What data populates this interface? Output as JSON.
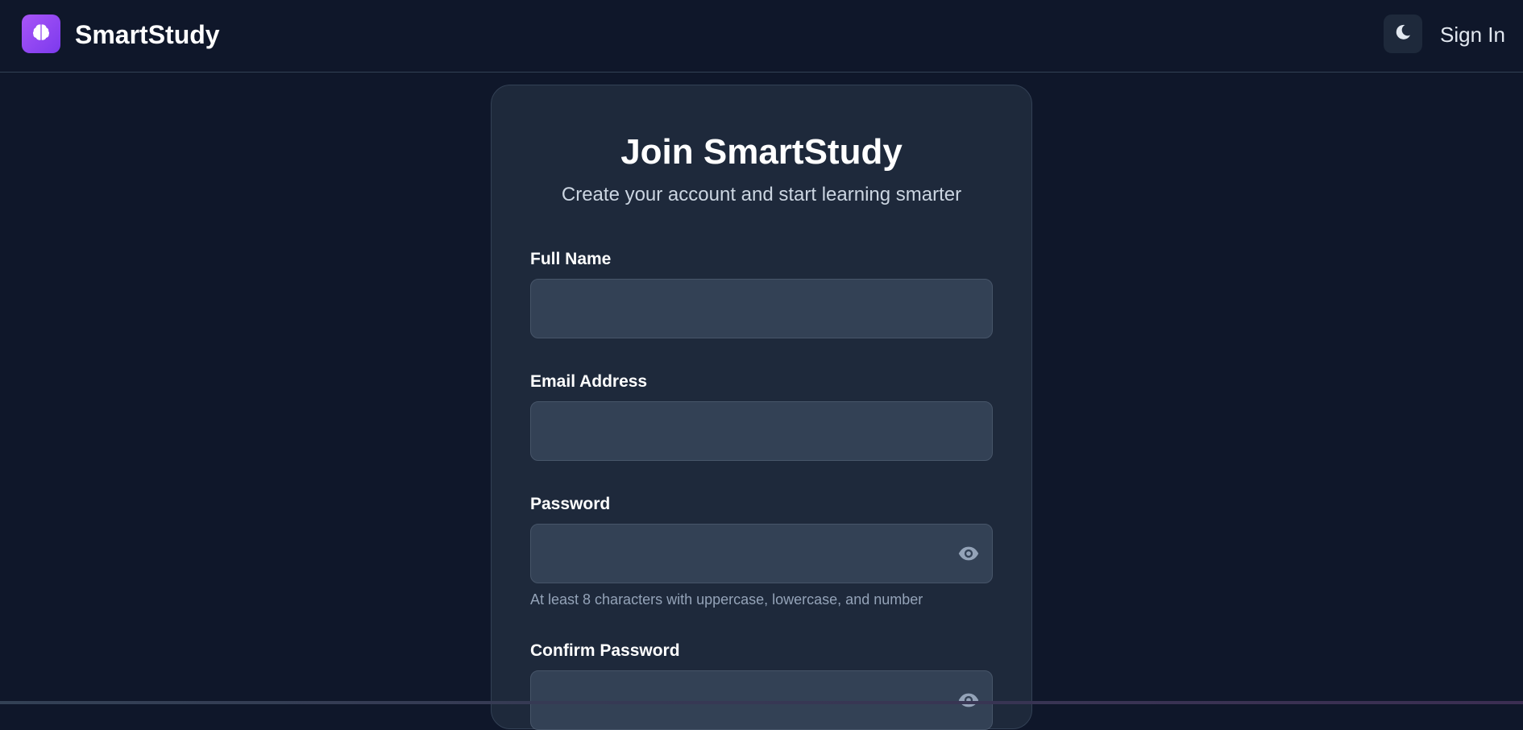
{
  "header": {
    "brand": "SmartStudy",
    "logo_icon": "brain-icon",
    "theme_icon": "moon-icon",
    "signin_label": "Sign In"
  },
  "signup": {
    "title": "Join SmartStudy",
    "subtitle": "Create your account and start learning smarter",
    "full_name": {
      "label": "Full Name",
      "value": ""
    },
    "email": {
      "label": "Email Address",
      "value": ""
    },
    "password": {
      "label": "Password",
      "value": "",
      "hint": "At least 8 characters with uppercase, lowercase, and number",
      "toggle_icon": "eye-icon"
    },
    "confirm_password": {
      "label": "Confirm Password",
      "value": "",
      "toggle_icon": "eye-icon"
    }
  },
  "colors": {
    "background": "#0f172a",
    "card": "#1e293b",
    "input": "#334155",
    "accent": "#9333ea"
  }
}
